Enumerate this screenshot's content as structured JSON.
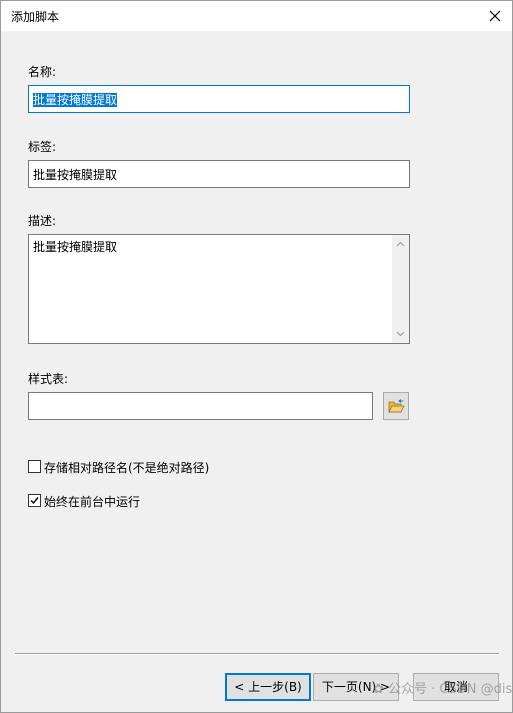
{
  "window": {
    "title": "添加脚本",
    "close_glyph": "✕"
  },
  "form": {
    "name": {
      "label": "名称:",
      "value": "批量按掩膜提取"
    },
    "tag": {
      "label": "标签:",
      "value": "批量按掩膜提取"
    },
    "description": {
      "label": "描述:",
      "value": "批量按掩膜提取"
    },
    "stylesheet": {
      "label": "样式表:",
      "value": ""
    },
    "options": [
      {
        "label": "存储相对路径名(不是绝对路径)",
        "checked": false
      },
      {
        "label": "始终在前台中运行",
        "checked": true
      }
    ]
  },
  "buttons": {
    "back": "< 上一步(B)",
    "next": "下一页(N) >",
    "cancel": "取消"
  },
  "watermark": "✿ 公众号 · CSDN @diseng",
  "colors": {
    "accent": "#0078d7",
    "dialog_bg": "#f0f0f0",
    "field_border": "#7a7a7a"
  },
  "icons": {
    "close": "close-icon",
    "browse": "folder-open-icon",
    "check": "check-icon",
    "scroll_up": "chevron-up-icon",
    "scroll_down": "chevron-down-icon"
  }
}
